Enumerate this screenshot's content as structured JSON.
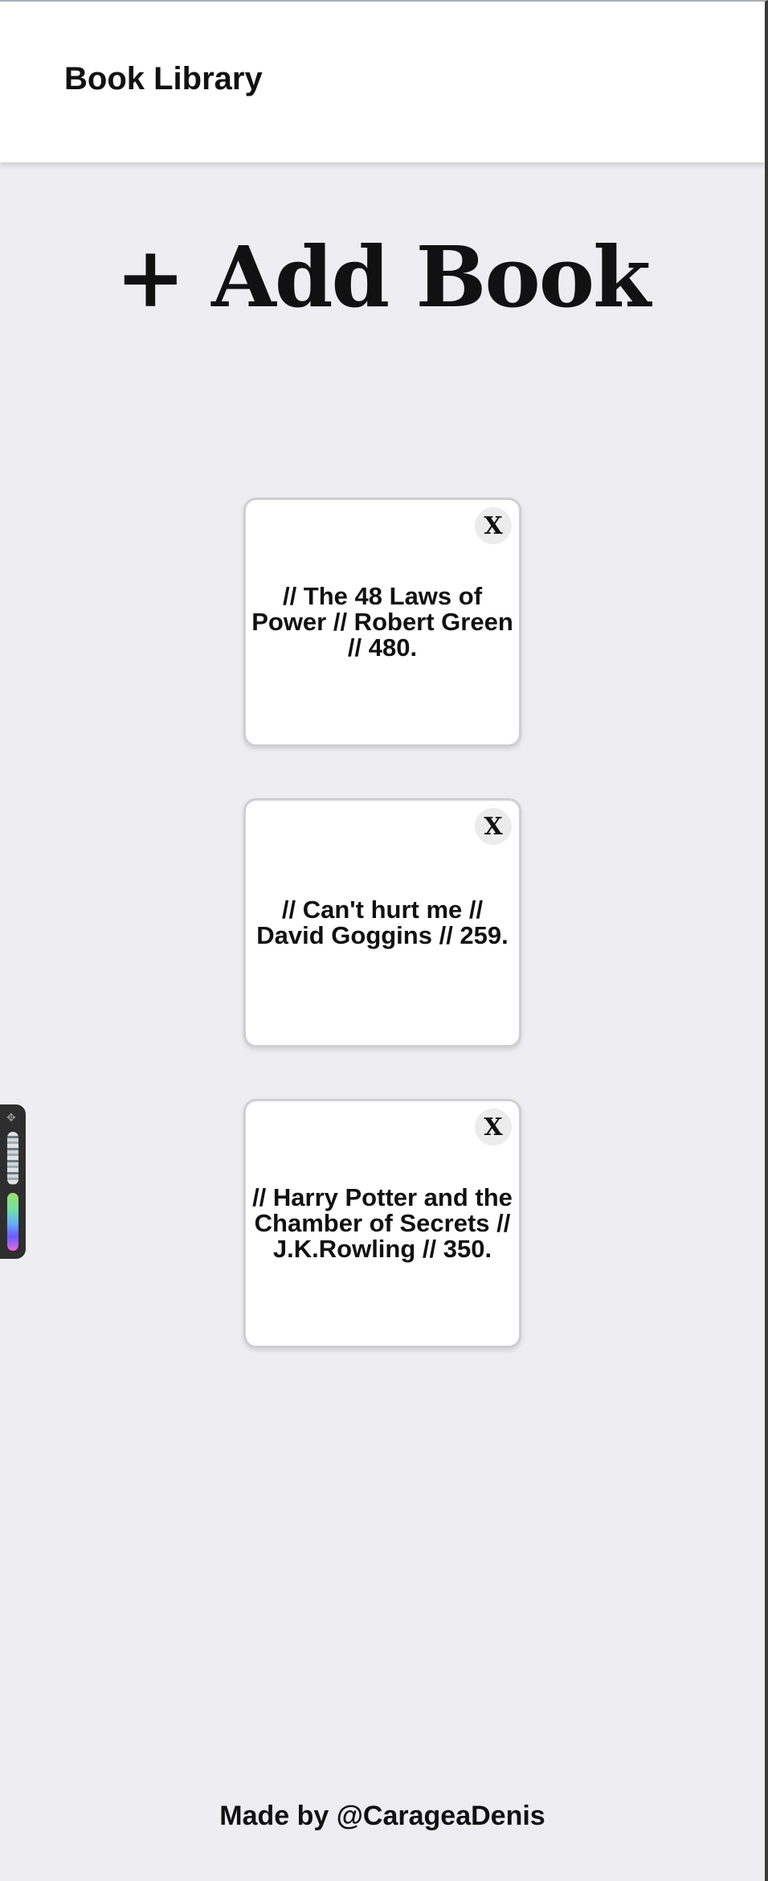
{
  "header": {
    "title": "Book Library"
  },
  "add_book": {
    "label": "+ Add Book"
  },
  "books": [
    {
      "text": "// The 48 Laws of Power // Robert Green // 480.",
      "close_label": "X"
    },
    {
      "text": "// Can't hurt me // David Goggins // 259.",
      "close_label": "X"
    },
    {
      "text": "// Harry Potter and the Chamber of Secrets // J.K.Rowling // 350.",
      "close_label": "X"
    }
  ],
  "footer": {
    "text": "Made by @CarageaDenis"
  },
  "side_widget": {
    "icon": "drag-handle-icon"
  },
  "colors": {
    "background": "#eeedf1",
    "card": "#ffffff",
    "text": "#111111"
  }
}
